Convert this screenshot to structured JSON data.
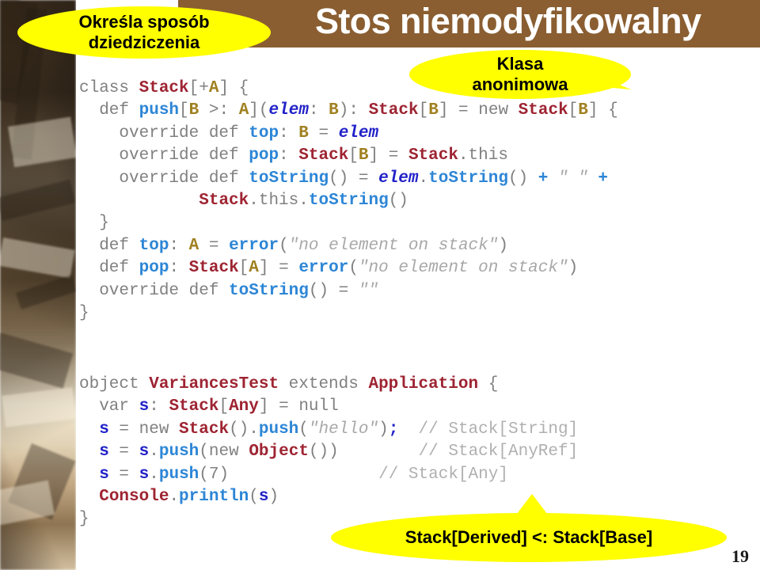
{
  "slide": {
    "title": "Stos niemodyfikowalny",
    "number": "19",
    "title_bar_color": "#8a5e31",
    "callout_color": "#ffff00",
    "panel_color": "#ffffff"
  },
  "callouts": {
    "inheritance": {
      "line1": "Określa sposób",
      "line2": "dziedziczenia"
    },
    "anonymous_class": {
      "line1": "Klasa",
      "line2": "anonimowa"
    },
    "subtyping": {
      "text": "Stack[Derived] <: Stack[Base]"
    }
  },
  "code_top": {
    "language": "scala",
    "lines": [
      "class Stack[+A] {",
      "  def push[B >: A](elem: B): Stack[B] = new Stack[B] {",
      "    override def top: B = elem",
      "    override def pop: Stack[B] = Stack.this",
      "    override def toString() = elem.toString() + \" \" +",
      "            Stack.this.toString()",
      "  }",
      "  def top: A = error(\"no element on stack\")",
      "  def pop: Stack[A] = error(\"no element on stack\")",
      "  override def toString() = \"\"",
      "}"
    ]
  },
  "code_bottom": {
    "language": "scala",
    "lines": [
      "object VariancesTest extends Application {",
      "  var s: Stack[Any] = null",
      "  s = new Stack().push(\"hello\");  // Stack[String]",
      "  s = s.push(new Object())        // Stack[AnyRef]",
      "  s = s.push(7)                   // Stack[Any]",
      "  Console.println(s)",
      "}"
    ]
  },
  "token_colors": {
    "plain": "#808080",
    "type": "#9e2432",
    "method": "#2d86d6",
    "type_param": "#a08020",
    "variable": "#2222c8",
    "string": "#a8a8a8",
    "comment": "#b0b0b0"
  }
}
